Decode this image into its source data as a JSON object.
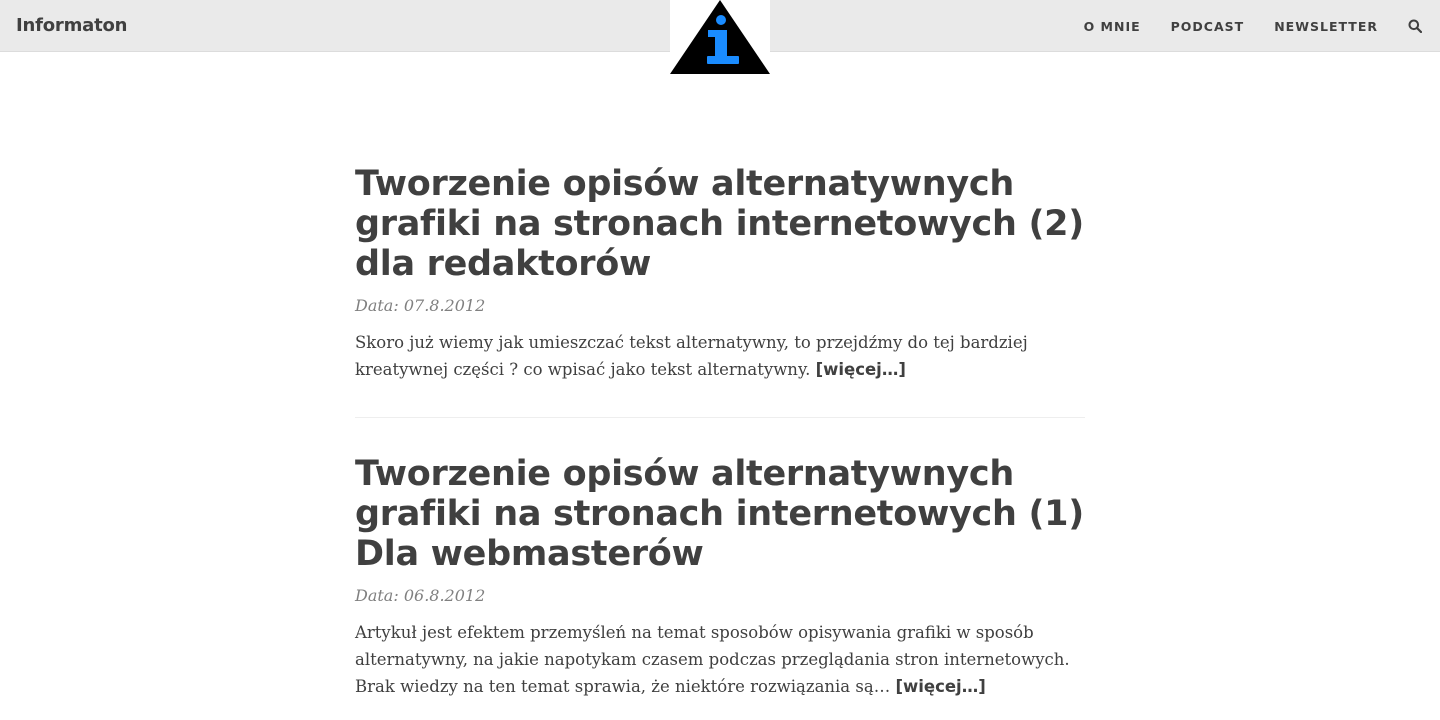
{
  "navbar": {
    "brand": "Informaton",
    "links": [
      "O MNIE",
      "PODCAST",
      "NEWSLETTER"
    ],
    "search_icon": "search-icon"
  },
  "logo": {
    "icon": "info-triangle-icon",
    "colors": {
      "triangle": "#000000",
      "glyph": "#1a8cff"
    }
  },
  "posts": [
    {
      "title": "Tworzenie opisów alternatywnych grafiki na stronach internetowych (2) dla redaktorów",
      "date_label": "Data:",
      "date": "07.8.2012",
      "excerpt": "Skoro już wiemy jak umieszczać tekst alternatywny, to przejdźmy do tej bardziej kreatywnej części ? co wpisać jako tekst alternatywny.",
      "more": "[więcej…]"
    },
    {
      "title": "Tworzenie opisów alternatywnych grafiki na stronach internetowych (1) Dla webmasterów",
      "date_label": "Data:",
      "date": "06.8.2012",
      "excerpt": "Artykuł jest efektem przemyśleń na temat sposobów opisywania grafiki w sposób alternatywny, na jakie napotykam czasem podczas przeglądania stron internetowych. Brak wiedzy na ten temat sprawia, że niektóre rozwiązania są…",
      "more": "[więcej…]"
    }
  ]
}
